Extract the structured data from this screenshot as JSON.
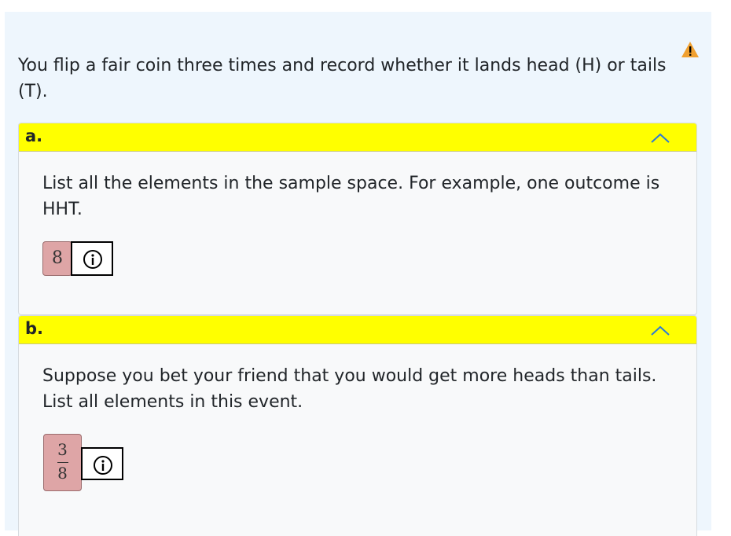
{
  "problem": {
    "statement": "You flip a fair coin three times and record whether it lands head (H) or tails (T).",
    "warning_icon": "warning-triangle-icon",
    "warning_color": "#f0a030"
  },
  "parts": [
    {
      "label": "a.",
      "text": "List all the elements in the sample space. For example, one outcome is HHT.",
      "answer": "8",
      "header_color": "#ffff00",
      "toggle_icon": "chevron-up-icon",
      "info_icon": "info-circle-icon"
    },
    {
      "label": "b.",
      "text": "Suppose you bet your friend that you would get more heads than tails. List all elements in this event.",
      "answer_numerator": "3",
      "answer_denominator": "8",
      "header_color": "#ffff00",
      "toggle_icon": "chevron-up-icon",
      "info_icon": "info-circle-icon"
    }
  ]
}
